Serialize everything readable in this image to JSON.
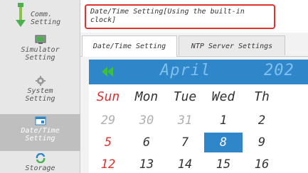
{
  "sidebar": {
    "items": [
      {
        "label": "Comm.\nSetting"
      },
      {
        "label": "Simulator\nSetting"
      },
      {
        "label": "System\nSetting"
      },
      {
        "label": "Date/Time\nSetting",
        "active": true
      },
      {
        "label": "Storage"
      }
    ]
  },
  "header": {
    "title": "Date/Time Setting[Using the built-in clock]"
  },
  "tabs": [
    {
      "label": "Date/Time Setting",
      "selected": true
    },
    {
      "label": "NTP Server Settings",
      "selected": false
    }
  ],
  "calendar": {
    "month": "April",
    "year": "202",
    "weekdays": [
      "Sun",
      "Mon",
      "Tue",
      "Wed",
      "Th"
    ],
    "weeks": [
      [
        "29",
        "30",
        "31",
        "1",
        "2"
      ],
      [
        "5",
        "6",
        "7",
        "8",
        "9"
      ],
      [
        "12",
        "13",
        "14",
        "15",
        "16"
      ]
    ],
    "selected_day": "8"
  },
  "colors": {
    "accent": "#2f86c9",
    "sunday": "#e03030",
    "highlight_box": "#e03030",
    "sidebar_bg": "#e7e7e7",
    "sidebar_active": "#bfbfbf"
  },
  "icons": [
    "comm-icon",
    "simulator-icon",
    "system-gear-icon",
    "calendar-icon",
    "storage-icon",
    "prev-month-icon"
  ]
}
